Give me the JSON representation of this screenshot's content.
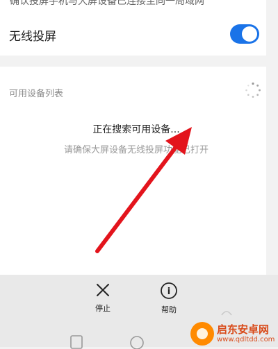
{
  "top_card": {
    "cut_text": "确认投屏手机与大屏设备已连接至同一局域网",
    "wireless_projection_label": "无线投屏",
    "toggle_on": true
  },
  "device_list": {
    "section_label": "可用设备列表",
    "searching_text": "正在搜索可用设备...",
    "hint_text": "请确保大屏设备无线投屏功能已打开"
  },
  "bottom_actions": {
    "stop_label": "停止",
    "help_label": "帮助",
    "help_glyph": "i"
  },
  "watermark": {
    "name": "启东安卓网",
    "url": "www.qdltdd.com"
  },
  "colors": {
    "accent": "#1a73e8",
    "arrow": "#e3141c",
    "watermark": "#d94b1a"
  }
}
